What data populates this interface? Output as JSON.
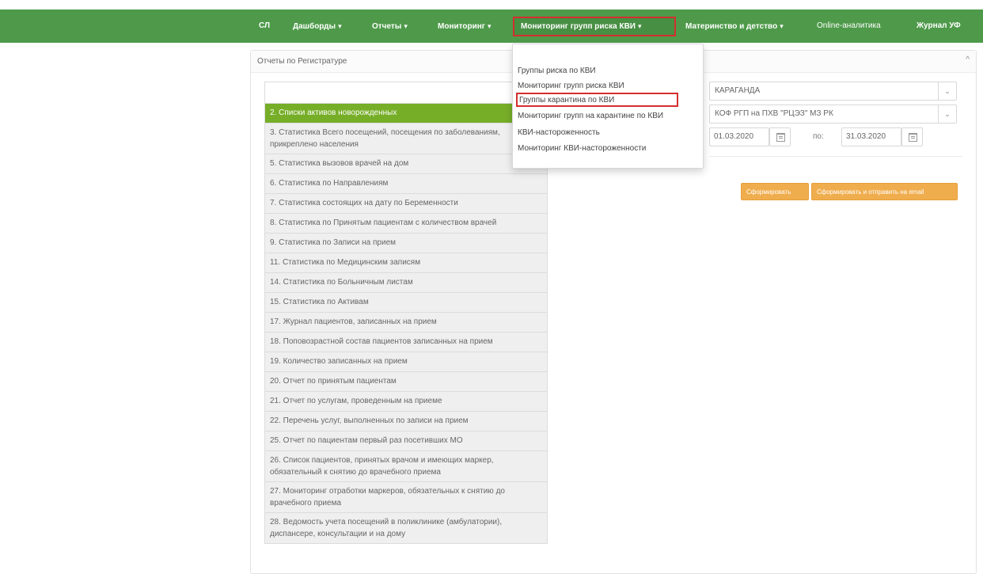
{
  "navbar": {
    "items": [
      {
        "label": "СЛ",
        "caret": ""
      },
      {
        "label": "Дашборды",
        "caret": "▾"
      },
      {
        "label": "Отчеты",
        "caret": "▾"
      },
      {
        "label": "Мониторинг",
        "caret": "▾"
      },
      {
        "label": "Мониторинг групп риска КВИ",
        "caret": "▾"
      },
      {
        "label": "Материнство и детство",
        "caret": "▾"
      },
      {
        "label": "Online-аналитика",
        "caret": ""
      },
      {
        "label": "Журнал УФ",
        "caret": ""
      }
    ],
    "active_index": 4
  },
  "panel": {
    "title": "Отчеты по Регистратуре",
    "collapse_glyph": "^"
  },
  "dropdown": {
    "items": [
      "Группы риска по КВИ",
      "Мониторинг групп риска КВИ",
      "Группы карантина по КВИ",
      "Мониторинг групп на карантине по КВИ",
      "КВИ-настороженность",
      "Мониторинг КВИ-настороженности"
    ],
    "highlighted_index": 2
  },
  "reports": {
    "active_index": 1,
    "items": [
      "",
      "2. Списки активов новорожденных",
      "3. Статистика Всего посещений, посещения по заболеваниям, прикреплено населения",
      "5. Статистика вызовов врачей на дом",
      "6. Статистика по Направлениям",
      "7. Статистика состоящих на дату по Беременности",
      "8. Статистика по Принятым пациентам с количеством врачей",
      "9. Статистика по Записи на прием",
      "11. Статистика по Медицинским записям",
      "14. Статистика по Больничным листам",
      "15. Статистика по Активам",
      "17. Журнал пациентов, записанных на прием",
      "18. Поповозрастной состав пациентов записанных на прием",
      "19. Количество записанных на прием",
      "20. Отчет по принятым пациентам",
      "21. Отчет по услугам, проведенным на приеме",
      "22. Перечень услуг, выполненных по записи на прием",
      "25. Отчет по пациентам первый раз посетивших МО",
      "26. Список пациентов, принятых врачом и имеющих маркер, обязательный к снятию до врачебного приема",
      "27. Мониторинг отработки маркеров, обязательных к снятию до врачебного приема",
      "28. Ведомость учета посещений в поликлинике (амбулатории), диспансере, консультации и на дому"
    ]
  },
  "filters": {
    "region": "КАРАГАНДА",
    "organization": "КОФ РГП на ПХВ \"РЦЭЗ\" МЗ РК",
    "date_from": "01.03.2020",
    "date_to_label": "по:",
    "date_to": "31.03.2020",
    "chevron": "⌄"
  },
  "buttons": {
    "generate": "Сформировать",
    "generate_email": "Сформировать и отправить на email"
  }
}
